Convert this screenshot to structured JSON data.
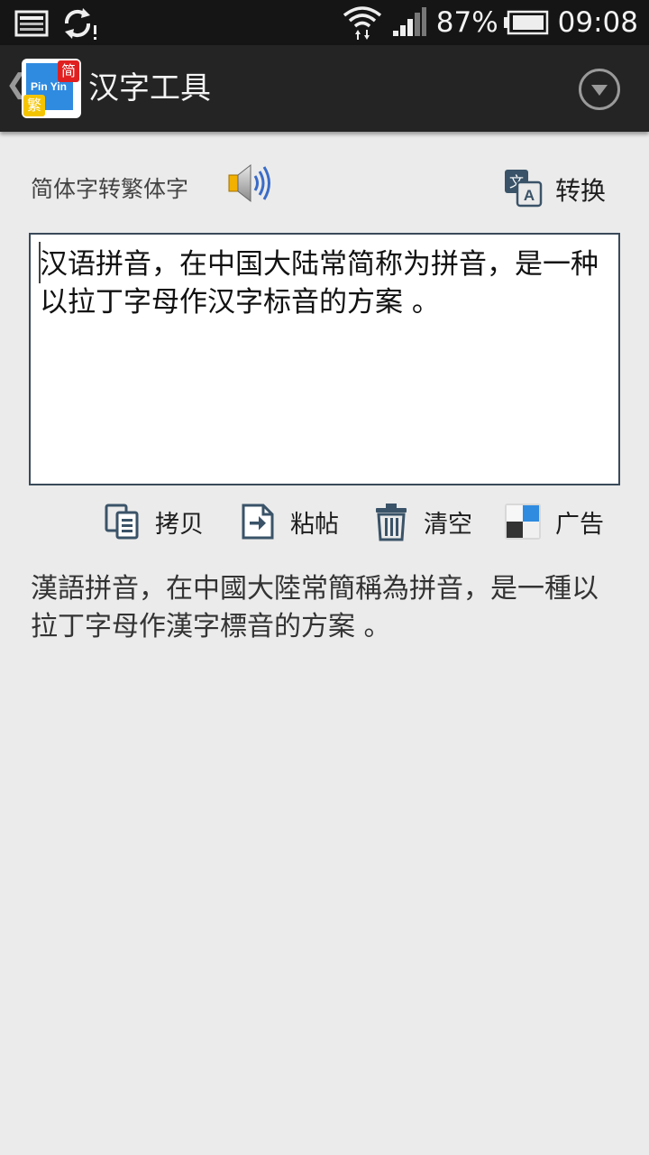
{
  "status_bar": {
    "battery_percent": "87%",
    "time": "09:08"
  },
  "action_bar": {
    "app_title": "汉字工具",
    "icon_text": {
      "pinyin": "Pin Yin",
      "simplified_badge": "简",
      "traditional_badge": "繁"
    }
  },
  "controls": {
    "mode_label": "简体字转繁体字",
    "convert_label": "转换"
  },
  "input": {
    "value": "汉语拼音，在中国大陆常简称为拼音，是一种以拉丁字母作汉字标音的方案 。"
  },
  "toolbar": {
    "copy_label": "拷贝",
    "paste_label": "粘帖",
    "clear_label": "清空",
    "ad_label": "广告"
  },
  "output": {
    "value": "漢語拼音，在中國大陸常簡稱為拼音，是一種以拉丁字母作漢字標音的方案 。"
  },
  "colors": {
    "status_bar_bg": "#151515",
    "action_bar_bg": "#242424",
    "content_bg": "#ebebeb",
    "icon_blue": "#2f8be0",
    "icon_red": "#e02020",
    "icon_yellow": "#f5c400",
    "tool_icon": "#3a5368"
  }
}
